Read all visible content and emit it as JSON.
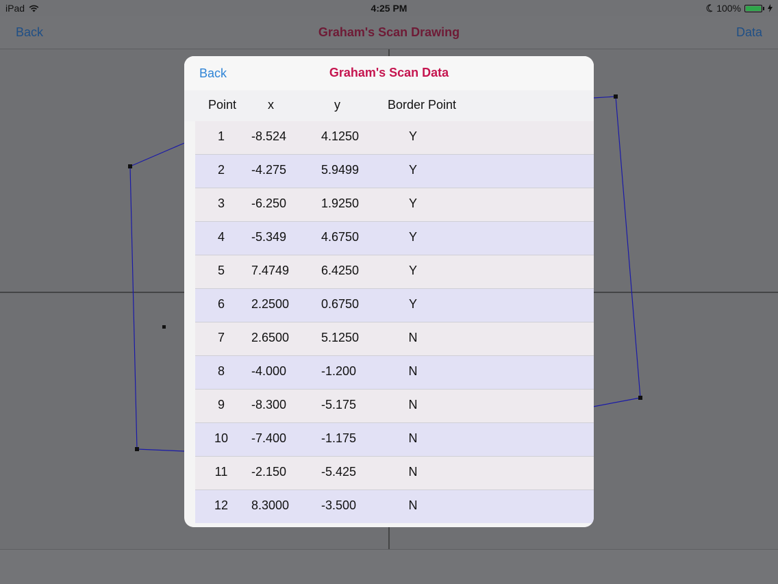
{
  "status_bar": {
    "device": "iPad",
    "time": "4:25 PM",
    "battery_percent": "100%",
    "battery_level": 1.0,
    "battery_color": "#2fa64a",
    "wifi_icon": "wifi-icon",
    "moon_icon": "moon-icon",
    "charging_icon": "charging-bolt-icon"
  },
  "nav": {
    "back_label": "Back",
    "title": "Graham's Scan Drawing",
    "data_label": "Data"
  },
  "modal": {
    "back_label": "Back",
    "title": "Graham's Scan Data",
    "columns": {
      "point": "Point",
      "x": "x",
      "y": "y",
      "border": "Border Point"
    },
    "rows": [
      {
        "point": "1",
        "x": "-8.524",
        "y": "4.1250",
        "border": "Y"
      },
      {
        "point": "2",
        "x": "-4.275",
        "y": "5.9499",
        "border": "Y"
      },
      {
        "point": "3",
        "x": "-6.250",
        "y": "1.9250",
        "border": "Y"
      },
      {
        "point": "4",
        "x": "-5.349",
        "y": "4.6750",
        "border": "Y"
      },
      {
        "point": "5",
        "x": "7.4749",
        "y": "6.4250",
        "border": "Y"
      },
      {
        "point": "6",
        "x": "2.2500",
        "y": "0.6750",
        "border": "Y"
      },
      {
        "point": "7",
        "x": "2.6500",
        "y": "5.1250",
        "border": "N"
      },
      {
        "point": "8",
        "x": "-4.000",
        "y": "-1.200",
        "border": "N"
      },
      {
        "point": "9",
        "x": "-8.300",
        "y": "-5.175",
        "border": "N"
      },
      {
        "point": "10",
        "x": "-7.400",
        "y": "-1.175",
        "border": "N"
      },
      {
        "point": "11",
        "x": "-2.150",
        "y": "-5.425",
        "border": "N"
      },
      {
        "point": "12",
        "x": "8.3000",
        "y": "-3.500",
        "border": "N"
      }
    ]
  },
  "colors": {
    "accent_blue": "#2f84d6",
    "title_red": "#c5154f",
    "hull_line": "#1a1aa8",
    "dim_overlay": "#6f7073"
  }
}
